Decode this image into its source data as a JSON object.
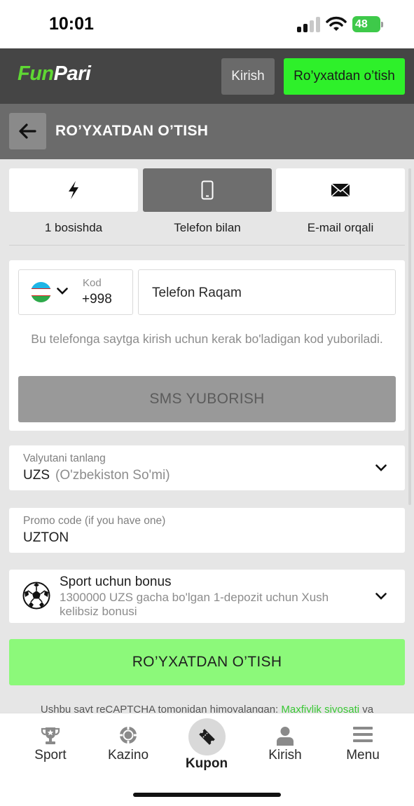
{
  "status": {
    "time": "10:01",
    "battery": "48"
  },
  "header": {
    "logo_fun": "Fun",
    "logo_pari": "Pari",
    "login_label": "Kirish",
    "register_label": "Ro’yxatdan o’tish"
  },
  "page": {
    "title": "RO’YXATDAN O’TISH"
  },
  "methods": [
    {
      "label": "1 bosishda",
      "icon": "lightning-icon"
    },
    {
      "label": "Telefon bilan",
      "icon": "smartphone-icon",
      "active": true
    },
    {
      "label": "E-mail orqali",
      "icon": "envelope-icon"
    }
  ],
  "phone": {
    "code_label": "Kod",
    "code_value": "+998",
    "placeholder": "Telefon Raqam",
    "hint": "Bu telefonga saytga kirish uchun kerak bo'ladigan kod yuboriladi.",
    "sms_button": "SMS YUBORISH"
  },
  "currency": {
    "label": "Valyutani tanlang",
    "code": "UZS",
    "name": "(O'zbekiston So'mi)"
  },
  "promo": {
    "label": "Promo code (if you have one)",
    "value": "UZTON"
  },
  "bonus": {
    "title": "Sport uchun bonus",
    "description": "1300000 UZS gacha bo'lgan 1-depozit uchun Xush kelibsiz bonusi"
  },
  "submit_label": "RO’YXATDAN O’TISH",
  "recaptcha": {
    "text": "Ushbu sayt reCAPTCHA tomonidan himoyalangan:",
    "link": "Maxfiylik siyosati",
    "tail": "va"
  },
  "tabbar": {
    "sport": "Sport",
    "kazino": "Kazino",
    "kupon": "Kupon",
    "kirish": "Kirish",
    "menu": "Menu"
  },
  "colors": {
    "brand_green": "#2ef02a",
    "submit_green": "#8cf97a",
    "header": "#454545",
    "titlebar": "#6b6b6b"
  }
}
